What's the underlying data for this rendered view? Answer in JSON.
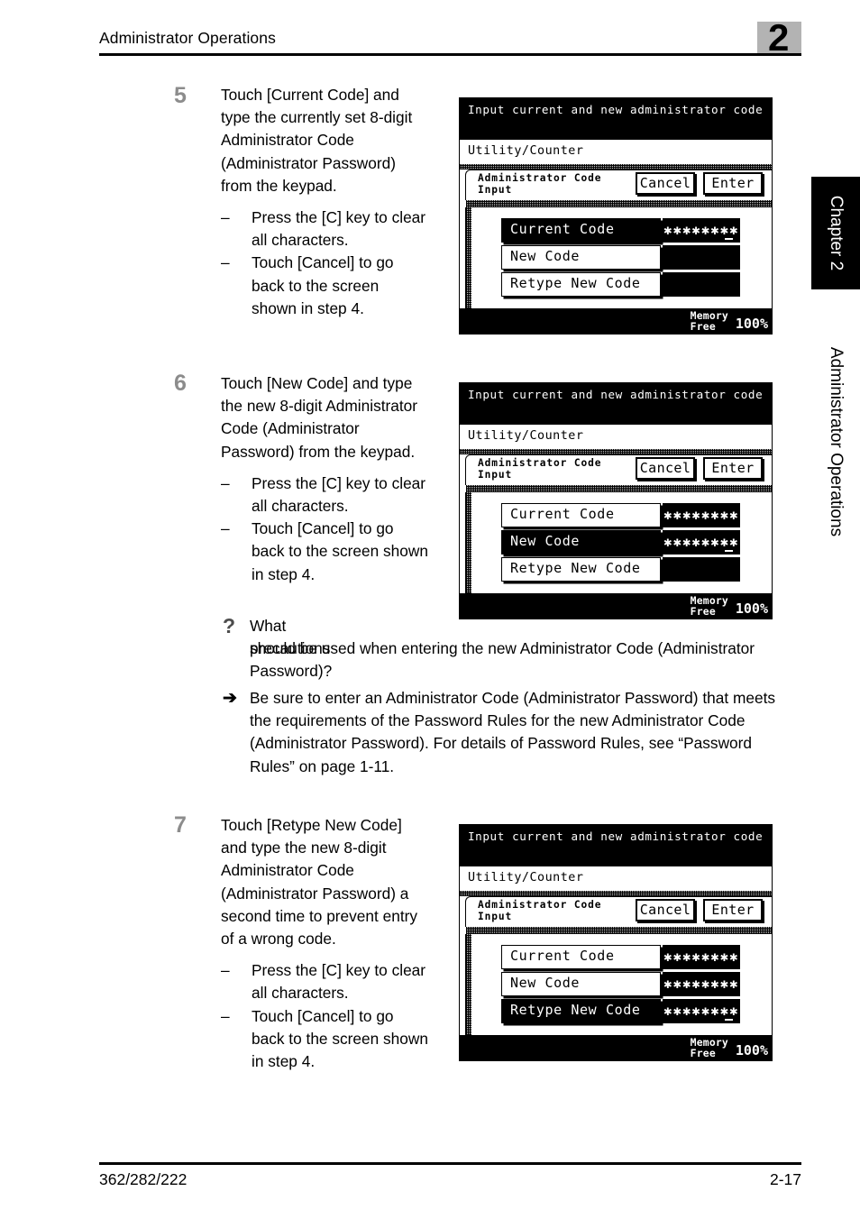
{
  "header": {
    "title": "Administrator Operations",
    "chapter_number": "2"
  },
  "side_tab": {
    "chapter_label": "Chapter 2",
    "section_label": "Administrator Operations"
  },
  "footer": {
    "model": "362/282/222",
    "page": "2-17"
  },
  "steps": [
    {
      "number": "5",
      "text": "Touch [Current Code] and type the currently set 8-digit Administrator Code (Administrator Password) from the keypad.",
      "bullets": [
        "Press the [C] key to clear all characters.",
        "Touch [Cancel] to go back to the screen shown in step 4."
      ]
    },
    {
      "number": "6",
      "text": "Touch [New Code] and type the new 8-digit Administrator Code (Administrator Password) from the keypad.",
      "bullets": [
        "Press the [C] key to clear all characters.",
        "Touch [Cancel] to go back to the screen shown in step 4."
      ]
    },
    {
      "number": "7",
      "text": "Touch [Retype New Code] and type the new 8-digit Administrator Code (Administrator Password) a second time to prevent entry of a wrong code.",
      "bullets": [
        "Press the [C] key to clear all characters.",
        "Touch [Cancel] to go back to the screen shown in step 4."
      ]
    }
  ],
  "qa": {
    "question_marker": "?",
    "question_first_line": "What precautions",
    "question_rest": "should be used when entering the new Administrator Code (Administrator Password)?",
    "answer_marker": "➔",
    "answer": "Be sure to enter an Administrator Code (Administrator Password) that meets the requirements of the Password Rules for the new Administrator Code (Administrator Password). For details of Password Rules, see “Password Rules” on page 1-11."
  },
  "lcd_common": {
    "title": "Input current and new administrator code",
    "subtitle": "Utility/Counter",
    "card_label": "Administrator Code\nInput",
    "cancel_label": "Cancel",
    "enter_label": "Enter",
    "memory_label": "Memory\nFree",
    "memory_value": "100%",
    "row_keys": [
      "Current Code",
      "New Code",
      "Retype New Code"
    ],
    "masked_value": "✱✱✱✱✱✱✱✱"
  },
  "lcd_screens": [
    {
      "id": "step5-screen",
      "selected_row": 0,
      "rows": [
        {
          "key": "Current Code",
          "value": "✱✱✱✱✱✱✱✱",
          "cursor": true,
          "selected": true
        },
        {
          "key": "New Code",
          "value": "",
          "cursor": false,
          "selected": false
        },
        {
          "key": "Retype New Code",
          "value": "",
          "cursor": false,
          "selected": false
        }
      ]
    },
    {
      "id": "step6-screen",
      "selected_row": 1,
      "rows": [
        {
          "key": "Current Code",
          "value": "✱✱✱✱✱✱✱✱",
          "cursor": false,
          "selected": false
        },
        {
          "key": "New Code",
          "value": "✱✱✱✱✱✱✱✱",
          "cursor": true,
          "selected": true
        },
        {
          "key": "Retype New Code",
          "value": "",
          "cursor": false,
          "selected": false
        }
      ]
    },
    {
      "id": "step7-screen",
      "selected_row": 2,
      "rows": [
        {
          "key": "Current Code",
          "value": "✱✱✱✱✱✱✱✱",
          "cursor": false,
          "selected": false
        },
        {
          "key": "New Code",
          "value": "✱✱✱✱✱✱✱✱",
          "cursor": false,
          "selected": false
        },
        {
          "key": "Retype New Code",
          "value": "✱✱✱✱✱✱✱✱",
          "cursor": true,
          "selected": true
        }
      ]
    }
  ],
  "colors": {
    "badge_gray": "#b3b3b3",
    "step_number_gray": "#8c8c8c",
    "lcd_black": "#000000"
  }
}
